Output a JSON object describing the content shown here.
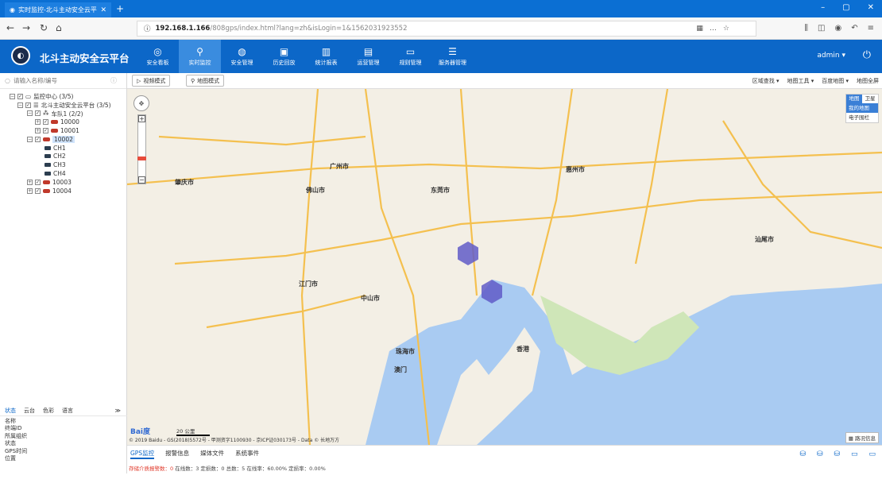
{
  "browser": {
    "tab_title": "实时监控-北斗主动安全云平台",
    "url_host": "192.168.1.166",
    "url_path": "/808gps/index.html?lang=zh&isLogin=1&1562031923552"
  },
  "app": {
    "title": "北斗主动安全云平台",
    "menu": [
      "安全看板",
      "实时监控",
      "安全管理",
      "历史回放",
      "统计报表",
      "运营管理",
      "规则管理",
      "服务器管理"
    ],
    "active_menu": "实时监控",
    "user": "admin"
  },
  "left": {
    "search_placeholder": "请输入名称/编号",
    "tree": {
      "root": "监控中心 (3/5)",
      "platform": "北斗主动安全云平台 (3/5)",
      "team": "车队1 (2/2)",
      "v1": "10000",
      "v2": "10001",
      "v3": "10002",
      "ch1": "CH1",
      "ch2": "CH2",
      "ch3": "CH3",
      "ch4": "CH4",
      "v4": "10003",
      "v5": "10004"
    },
    "tabs": [
      "状态",
      "云台",
      "色彩",
      "语言"
    ],
    "props": [
      "名称",
      "终端ID",
      "所属组织",
      "状态",
      "GPS时间",
      "位置"
    ]
  },
  "map_toolbar": {
    "video_mode": "视频模式",
    "map_mode": "地图模式",
    "right": [
      "区域查找",
      "地图工具",
      "百度地图",
      "地图全屏"
    ]
  },
  "map": {
    "type_map": "地图",
    "type_sat": "卫星",
    "opt1": "我的地图",
    "opt2": "电子围栏",
    "labels": [
      "肇庆市",
      "广州市",
      "佛山市",
      "东莞市",
      "惠州市",
      "江门市",
      "中山市",
      "珠海市",
      "澳门",
      "香港",
      "汕尾市"
    ],
    "scale": "20 公里",
    "copyright": "© 2019 Baidu - GS(2018)5572号 - 甲测资字1100930 - 京ICP证030173号 - Data © 长地万方",
    "traffic": "路况信息"
  },
  "bottom": {
    "tabs": [
      "GPS监控",
      "报警信息",
      "媒体文件",
      "系统事件"
    ],
    "alarm_label": "存储介质报警数：0",
    "status_text": "在线数：3   定损数：0   总数：5   在线率：60.00%   定损率：0.00%"
  }
}
